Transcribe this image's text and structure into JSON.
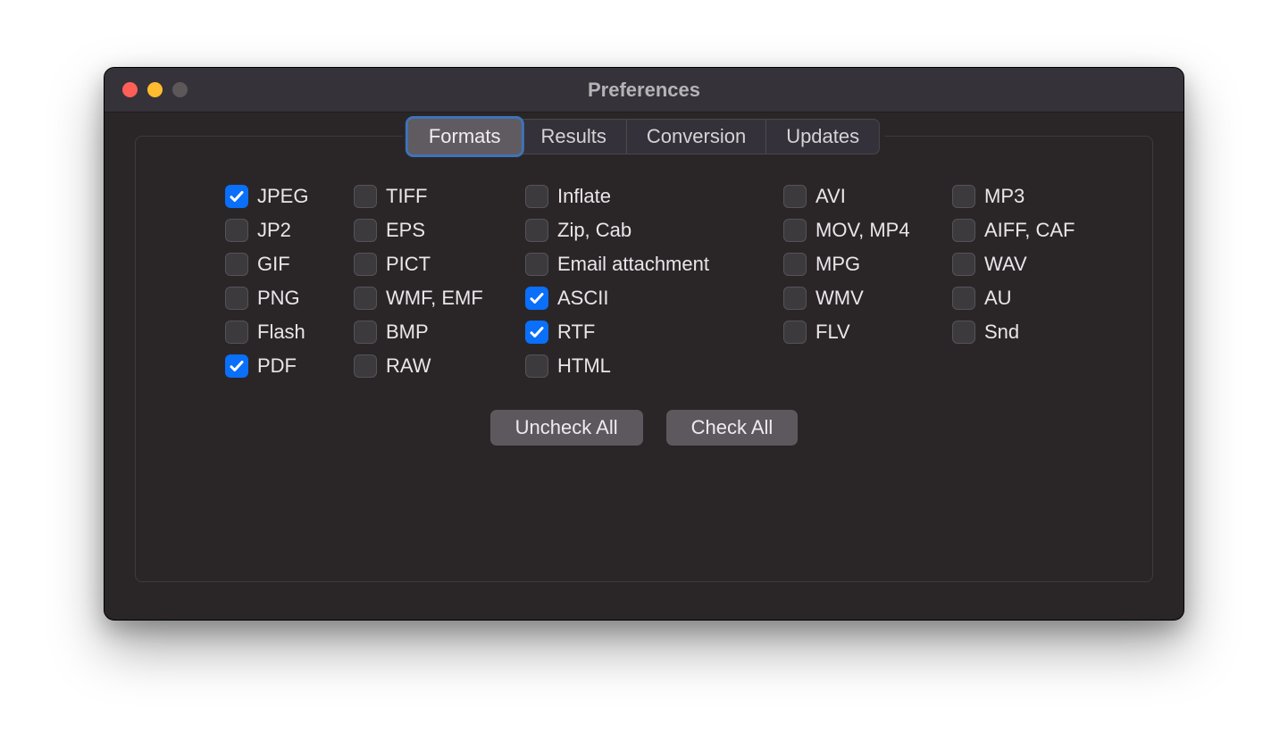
{
  "window": {
    "title": "Preferences"
  },
  "tabs": {
    "formats": "Formats",
    "results": "Results",
    "conversion": "Conversion",
    "updates": "Updates",
    "active": "formats"
  },
  "formats": {
    "col1": [
      {
        "label": "JPEG",
        "checked": true
      },
      {
        "label": "JP2",
        "checked": false
      },
      {
        "label": "GIF",
        "checked": false
      },
      {
        "label": "PNG",
        "checked": false
      },
      {
        "label": "Flash",
        "checked": false
      },
      {
        "label": "PDF",
        "checked": true
      }
    ],
    "col2": [
      {
        "label": "TIFF",
        "checked": false
      },
      {
        "label": "EPS",
        "checked": false
      },
      {
        "label": "PICT",
        "checked": false
      },
      {
        "label": "WMF, EMF",
        "checked": false
      },
      {
        "label": "BMP",
        "checked": false
      },
      {
        "label": "RAW",
        "checked": false
      }
    ],
    "col3": [
      {
        "label": "Inflate",
        "checked": false
      },
      {
        "label": "Zip, Cab",
        "checked": false
      },
      {
        "label": "Email attachment",
        "checked": false
      },
      {
        "label": "ASCII",
        "checked": true
      },
      {
        "label": "RTF",
        "checked": true
      },
      {
        "label": "HTML",
        "checked": false
      }
    ],
    "col4": [
      {
        "label": "AVI",
        "checked": false
      },
      {
        "label": "MOV, MP4",
        "checked": false
      },
      {
        "label": "MPG",
        "checked": false
      },
      {
        "label": "WMV",
        "checked": false
      },
      {
        "label": "FLV",
        "checked": false
      }
    ],
    "col5": [
      {
        "label": "MP3",
        "checked": false
      },
      {
        "label": "AIFF, CAF",
        "checked": false
      },
      {
        "label": "WAV",
        "checked": false
      },
      {
        "label": "AU",
        "checked": false
      },
      {
        "label": "Snd",
        "checked": false
      }
    ]
  },
  "buttons": {
    "uncheck_all": "Uncheck All",
    "check_all": "Check All"
  }
}
